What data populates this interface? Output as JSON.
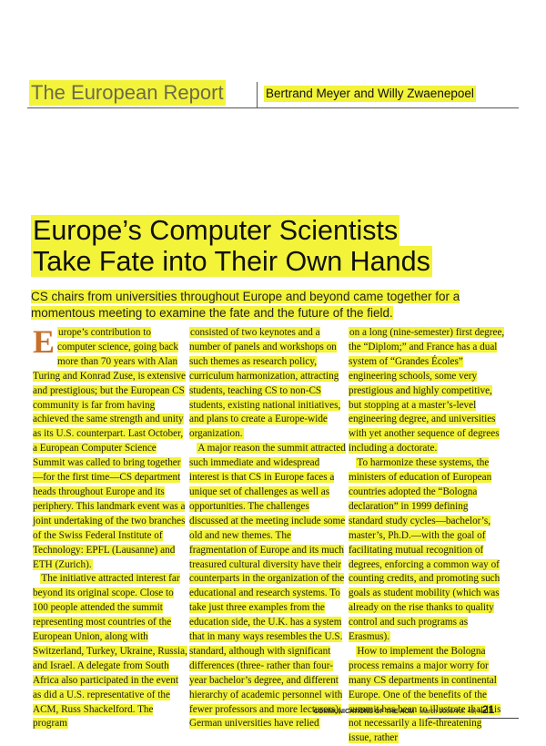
{
  "header": {
    "section": "The European Report",
    "authors": "Bertrand Meyer and Willy Zwaenepoel"
  },
  "article": {
    "title_line1": "Europe’s Computer Scientists",
    "title_line2": "Take Fate into Their Own Hands",
    "subtitle": "CS chairs from universities throughout Europe and beyond came together for a momentous meeting to examine the fate and the future of the field.",
    "dropcap": "E",
    "col1_p1": "urope’s contribution to computer science, going back more than 70 years with Alan Turing and Konrad Zuse, is extensive and prestigious; but the European CS community is far from having achieved the same strength and unity as its U.S. counterpart. Last October, a European Computer Science Summit was called to bring together—for the first time—CS department heads throughout Europe and its periphery. This landmark event was a joint undertaking of the two branches of the Swiss Federal Institute of Technology: EPFL (Lausanne) and ETH (Zurich).",
    "col1_p2": "The initiative attracted interest far beyond its original scope. Close to 100 people attended the summit representing most countries of the European Union, along with Switzerland, Turkey, Ukraine, Russia, and Israel. A delegate from South Africa also participated in the event as did a U.S. representative of the ACM, Russ Shackelford. The program",
    "col2_p1": "consisted of two keynotes and a number of panels and workshops on such themes as research policy, curriculum harmonization, attracting students, teaching CS to non-CS students, existing national initiatives, and plans to create a Europe-wide organization.",
    "col2_p2": "A major reason the summit attracted such immediate and widespread interest is that CS in Europe faces a unique set of challenges as well as opportunities. The challenges discussed at the meeting include some old and new themes. The fragmentation of Europe and its much treasured cultural diversity have their counterparts in the organization of the educational and research systems. To take just three examples from the education side, the U.K. has a system that in many ways resembles the U.S. standard, although with significant differences (three- rather than four-year bachelor’s degree, and different hierarchy of academic personnel with fewer professors and more lecturers); German universities have relied",
    "col3_p1": "on a long (nine-semester) first degree, the “Diplom;” and France has a dual system of “Grandes Écoles” engineering schools, some very prestigious and highly competitive, but stopping at a master’s-level engineering degree, and universities with yet another sequence of degrees including a doctorate.",
    "col3_p2": "To harmonize these systems, the ministers of education of European countries adopted the “Bologna declaration” in 1999 defining standard study cycles—bachelor’s, master’s, Ph.D.—with the goal of facilitating mutual recognition of degrees, enforcing a common way of counting credits, and promoting such goals as student mobility (which was already on the rise thanks to quality control and such programs as Erasmus).",
    "col3_p3": "How to implement the Bologna process remains a major worry for many CS departments in continental Europe. One of the benefits of the summit has been to illustrate that it is not necessarily a life-threatening issue, rather"
  },
  "footer": {
    "publication": "COMMUNICATIONS OF THE ACM",
    "issue": "March 2006/Vol. 49, No. 3",
    "page": "21"
  },
  "colors": {
    "highlight": "#f3f33a",
    "dropcap": "#c8702a",
    "section_title": "#6b6b4a"
  }
}
